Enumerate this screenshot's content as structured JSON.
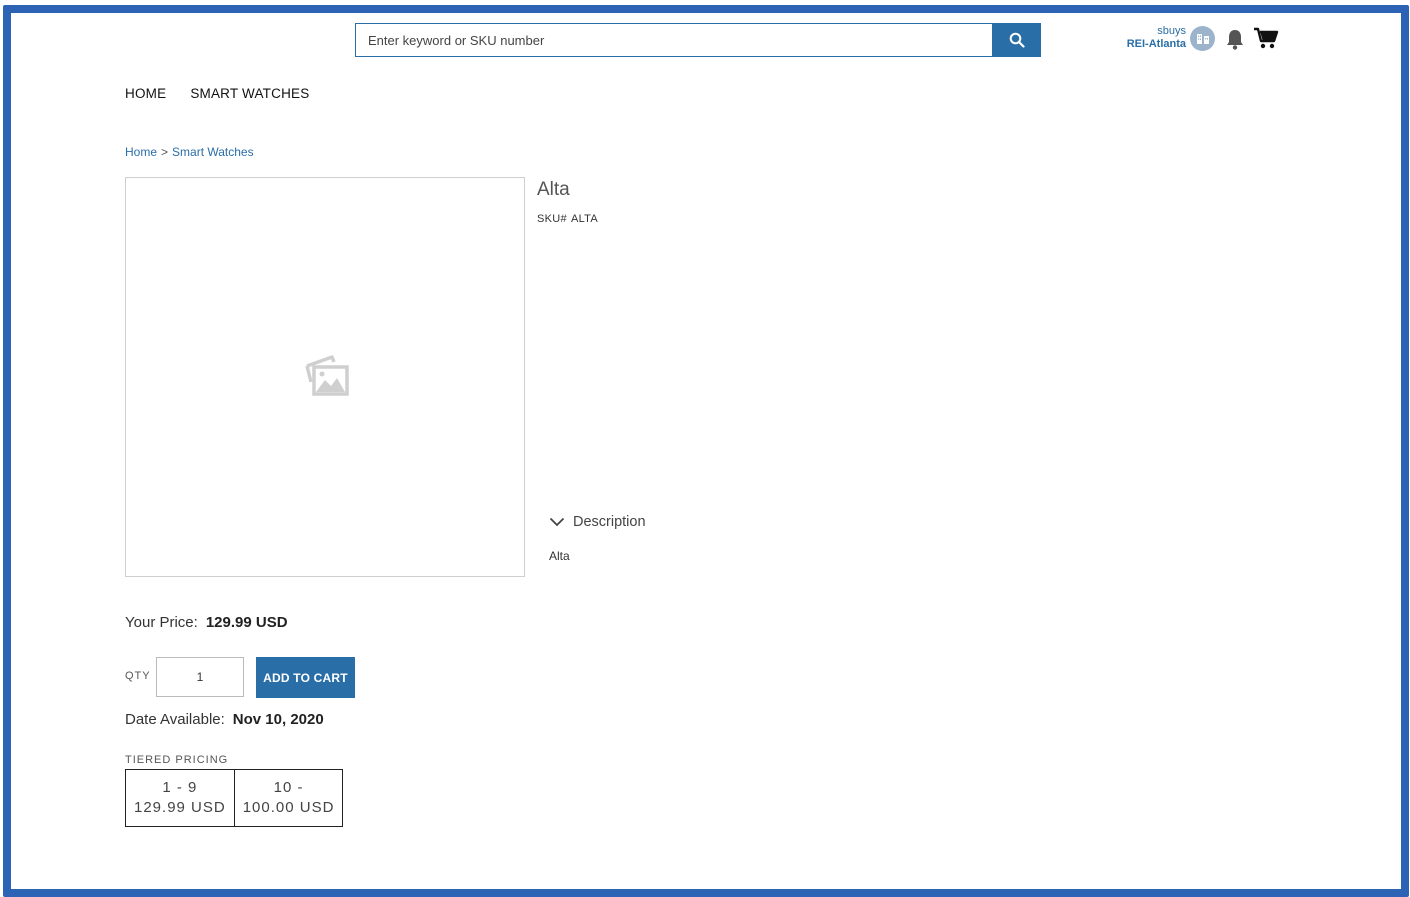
{
  "search": {
    "placeholder": "Enter keyword or SKU number"
  },
  "account": {
    "user": "sbuys",
    "org": "REI-Atlanta"
  },
  "nav": {
    "items": [
      {
        "label": "HOME"
      },
      {
        "label": "SMART WATCHES"
      }
    ]
  },
  "breadcrumb": {
    "items": [
      {
        "label": "Home"
      },
      {
        "label": "Smart Watches"
      }
    ],
    "separator": ">"
  },
  "product": {
    "name": "Alta",
    "sku_label": "SKU#",
    "sku": "ALTA",
    "description_label": "Description",
    "description": "Alta",
    "price_label": "Your Price:",
    "price": "129.99 USD",
    "qty_label": "QTY",
    "qty": "1",
    "add_to_cart": "ADD TO CART",
    "available_label": "Date Available:",
    "available": "Nov 10, 2020",
    "tiered_label": "TIERED PRICING",
    "tiers": [
      {
        "range": "1 - 9",
        "price": "129.99 USD"
      },
      {
        "range": "10 -",
        "price": "100.00 USD"
      }
    ]
  },
  "colors": {
    "frame": "#2c63b5",
    "accent": "#2a6ea7",
    "badge": "#9cb3cc"
  },
  "icons": [
    "search-icon",
    "account-icon",
    "bell-icon",
    "cart-icon",
    "image-placeholder-icon",
    "chevron-down-icon"
  ]
}
